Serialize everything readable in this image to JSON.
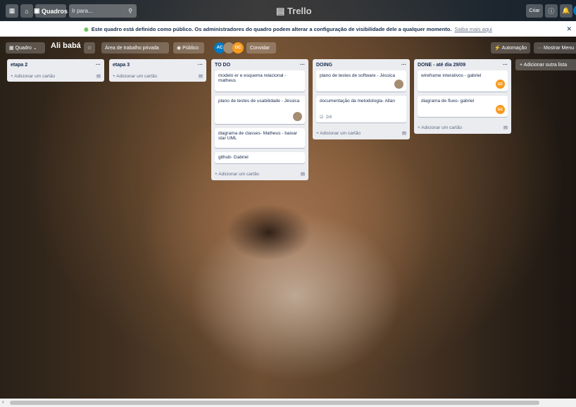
{
  "topbar": {
    "boards_label": "Quadros",
    "search_placeholder": "Ir para...",
    "logo": "Trello",
    "create_label": "Criar"
  },
  "banner": {
    "text": "Este quadro está definido como público. Os administradores do quadro podem alterar a configuração de visibilidade dele a qualquer momento.",
    "link": "Saiba mais aqui"
  },
  "boardbar": {
    "view_label": "Quadro",
    "board_name": "Ali babá",
    "workspace_label": "Área de trabalho privada",
    "visibility_label": "Público",
    "invite_label": "Convidar",
    "automation_label": "Automação",
    "menu_label": "Mostrar Menu",
    "members": [
      "AC",
      "",
      "GC"
    ]
  },
  "lists": [
    {
      "title": "etapa 2",
      "cards": [],
      "add_label": "+ Adicionar um cartão"
    },
    {
      "title": "etapa 3",
      "cards": [],
      "add_label": "+ Adicionar um cartão"
    },
    {
      "title": "TO DO",
      "add_label": "+ Adicionar um cartão",
      "cards": [
        {
          "text": "modelo er e esquema relacional - matheus"
        },
        {
          "text": "plano de testes de usabilidade - Jéssica",
          "avatar": "photo"
        },
        {
          "text": "diagrama de classes- Matheus - baixar star UML"
        },
        {
          "text": "github- Gabriel"
        }
      ]
    },
    {
      "title": "DOING",
      "add_label": "+ Adicionar um cartão",
      "cards": [
        {
          "text": "plano de testes de software - Jéssica",
          "avatar": "photo"
        },
        {
          "text": "documentação da metodologia- Allan",
          "checklist": "2/4"
        }
      ]
    },
    {
      "title": "DONE - até dia 29/09",
      "add_label": "+ Adicionar um cartão",
      "cards": [
        {
          "text": "wireframe interativos - gabriel",
          "avatar": "GC"
        },
        {
          "text": "diagrama de fluxo- gabriel",
          "avatar": "GC"
        }
      ]
    }
  ],
  "add_list_label": "+ Adicionar outra lista",
  "colors": {
    "avatar_gc": "#f89a1c",
    "avatar_ac": "#0079bf",
    "card_text": "#172b4d"
  }
}
